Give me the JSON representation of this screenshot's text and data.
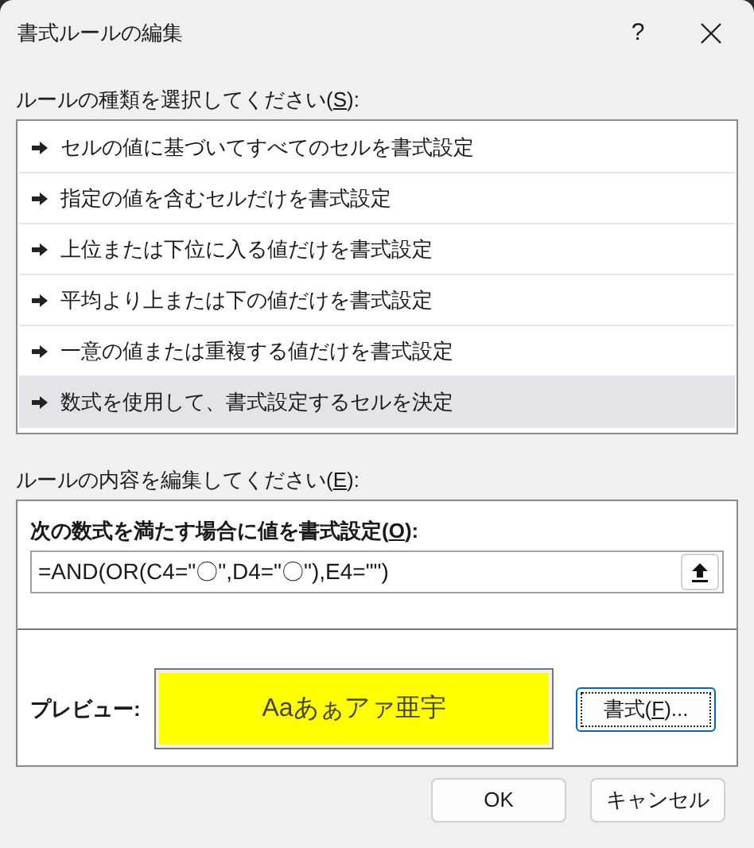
{
  "window": {
    "title": "書式ルールの編集",
    "help": "?"
  },
  "rule_type_label": {
    "before": "ルールの種類を選択してください(",
    "key": "S",
    "after": "):"
  },
  "rule_types": [
    {
      "label": "セルの値に基づいてすべてのセルを書式設定",
      "selected": false
    },
    {
      "label": "指定の値を含むセルだけを書式設定",
      "selected": false
    },
    {
      "label": "上位または下位に入る値だけを書式設定",
      "selected": false
    },
    {
      "label": "平均より上または下の値だけを書式設定",
      "selected": false
    },
    {
      "label": "一意の値または重複する値だけを書式設定",
      "selected": false
    },
    {
      "label": "数式を使用して、書式設定するセルを決定",
      "selected": true
    }
  ],
  "rule_edit_label": {
    "before": "ルールの内容を編集してください(",
    "key": "E",
    "after": "):"
  },
  "formula_label": {
    "before": "次の数式を満たす場合に値を書式設定(",
    "key": "O",
    "after": "):"
  },
  "formula": {
    "value": "=AND(OR(C4=\"〇\",D4=\"〇\"),E4=\"\")"
  },
  "preview": {
    "label": "プレビュー:",
    "sample": "Aaあぁアァ亜宇",
    "color": "#ffff00"
  },
  "format_button": {
    "before": "書式(",
    "key": "F",
    "after": ")..."
  },
  "buttons": [
    "OK",
    "キャンセル"
  ]
}
